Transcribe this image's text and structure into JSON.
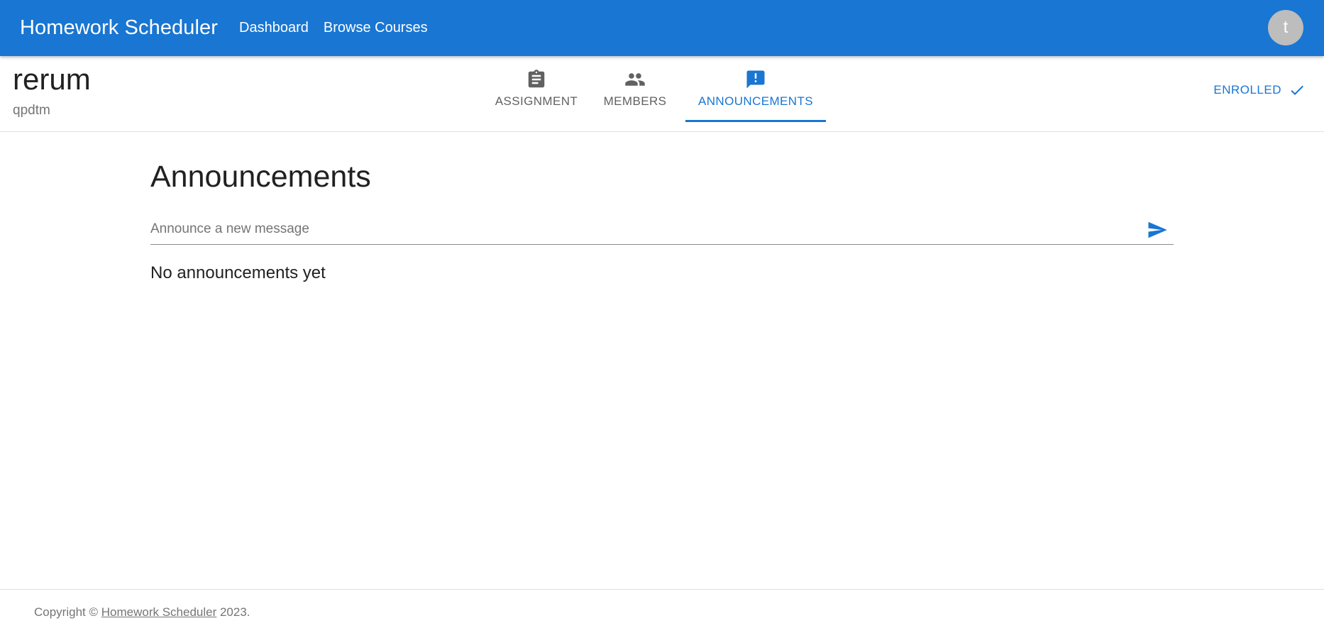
{
  "appbar": {
    "brand": "Homework Scheduler",
    "nav": [
      "Dashboard",
      "Browse Courses"
    ],
    "avatar_initial": "t",
    "color": "#1976d2"
  },
  "course": {
    "title": "rerum",
    "code": "qpdtm",
    "enroll_status": "ENROLLED"
  },
  "tabs": [
    {
      "label": "ASSIGNMENT",
      "icon": "clipboard-icon",
      "active": false
    },
    {
      "label": "MEMBERS",
      "icon": "people-icon",
      "active": false
    },
    {
      "label": "ANNOUNCEMENTS",
      "icon": "announcement-icon",
      "active": true
    }
  ],
  "main": {
    "title": "Announcements",
    "input_placeholder": "Announce a new message",
    "input_value": "",
    "empty_message": "No announcements yet"
  },
  "footer": {
    "prefix": "Copyright © ",
    "link": "Homework Scheduler",
    "suffix": " 2023."
  }
}
